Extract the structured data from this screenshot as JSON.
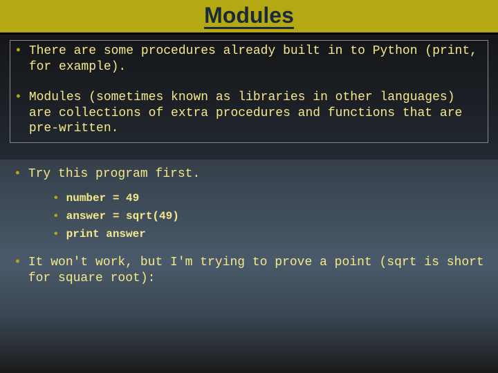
{
  "title": "Modules",
  "bullets": {
    "b1": "There are some procedures already built in to Python (print, for example).",
    "b2": "Modules (sometimes known as libraries in other languages) are collections of extra procedures and functions that are pre-written.",
    "b3": "Try this program first.",
    "b4": "It won't work, but I'm trying to prove a point (sqrt is short for square root):"
  },
  "code": {
    "c1": "number = 49",
    "c2": "answer = sqrt(49)",
    "c3": "print answer"
  }
}
